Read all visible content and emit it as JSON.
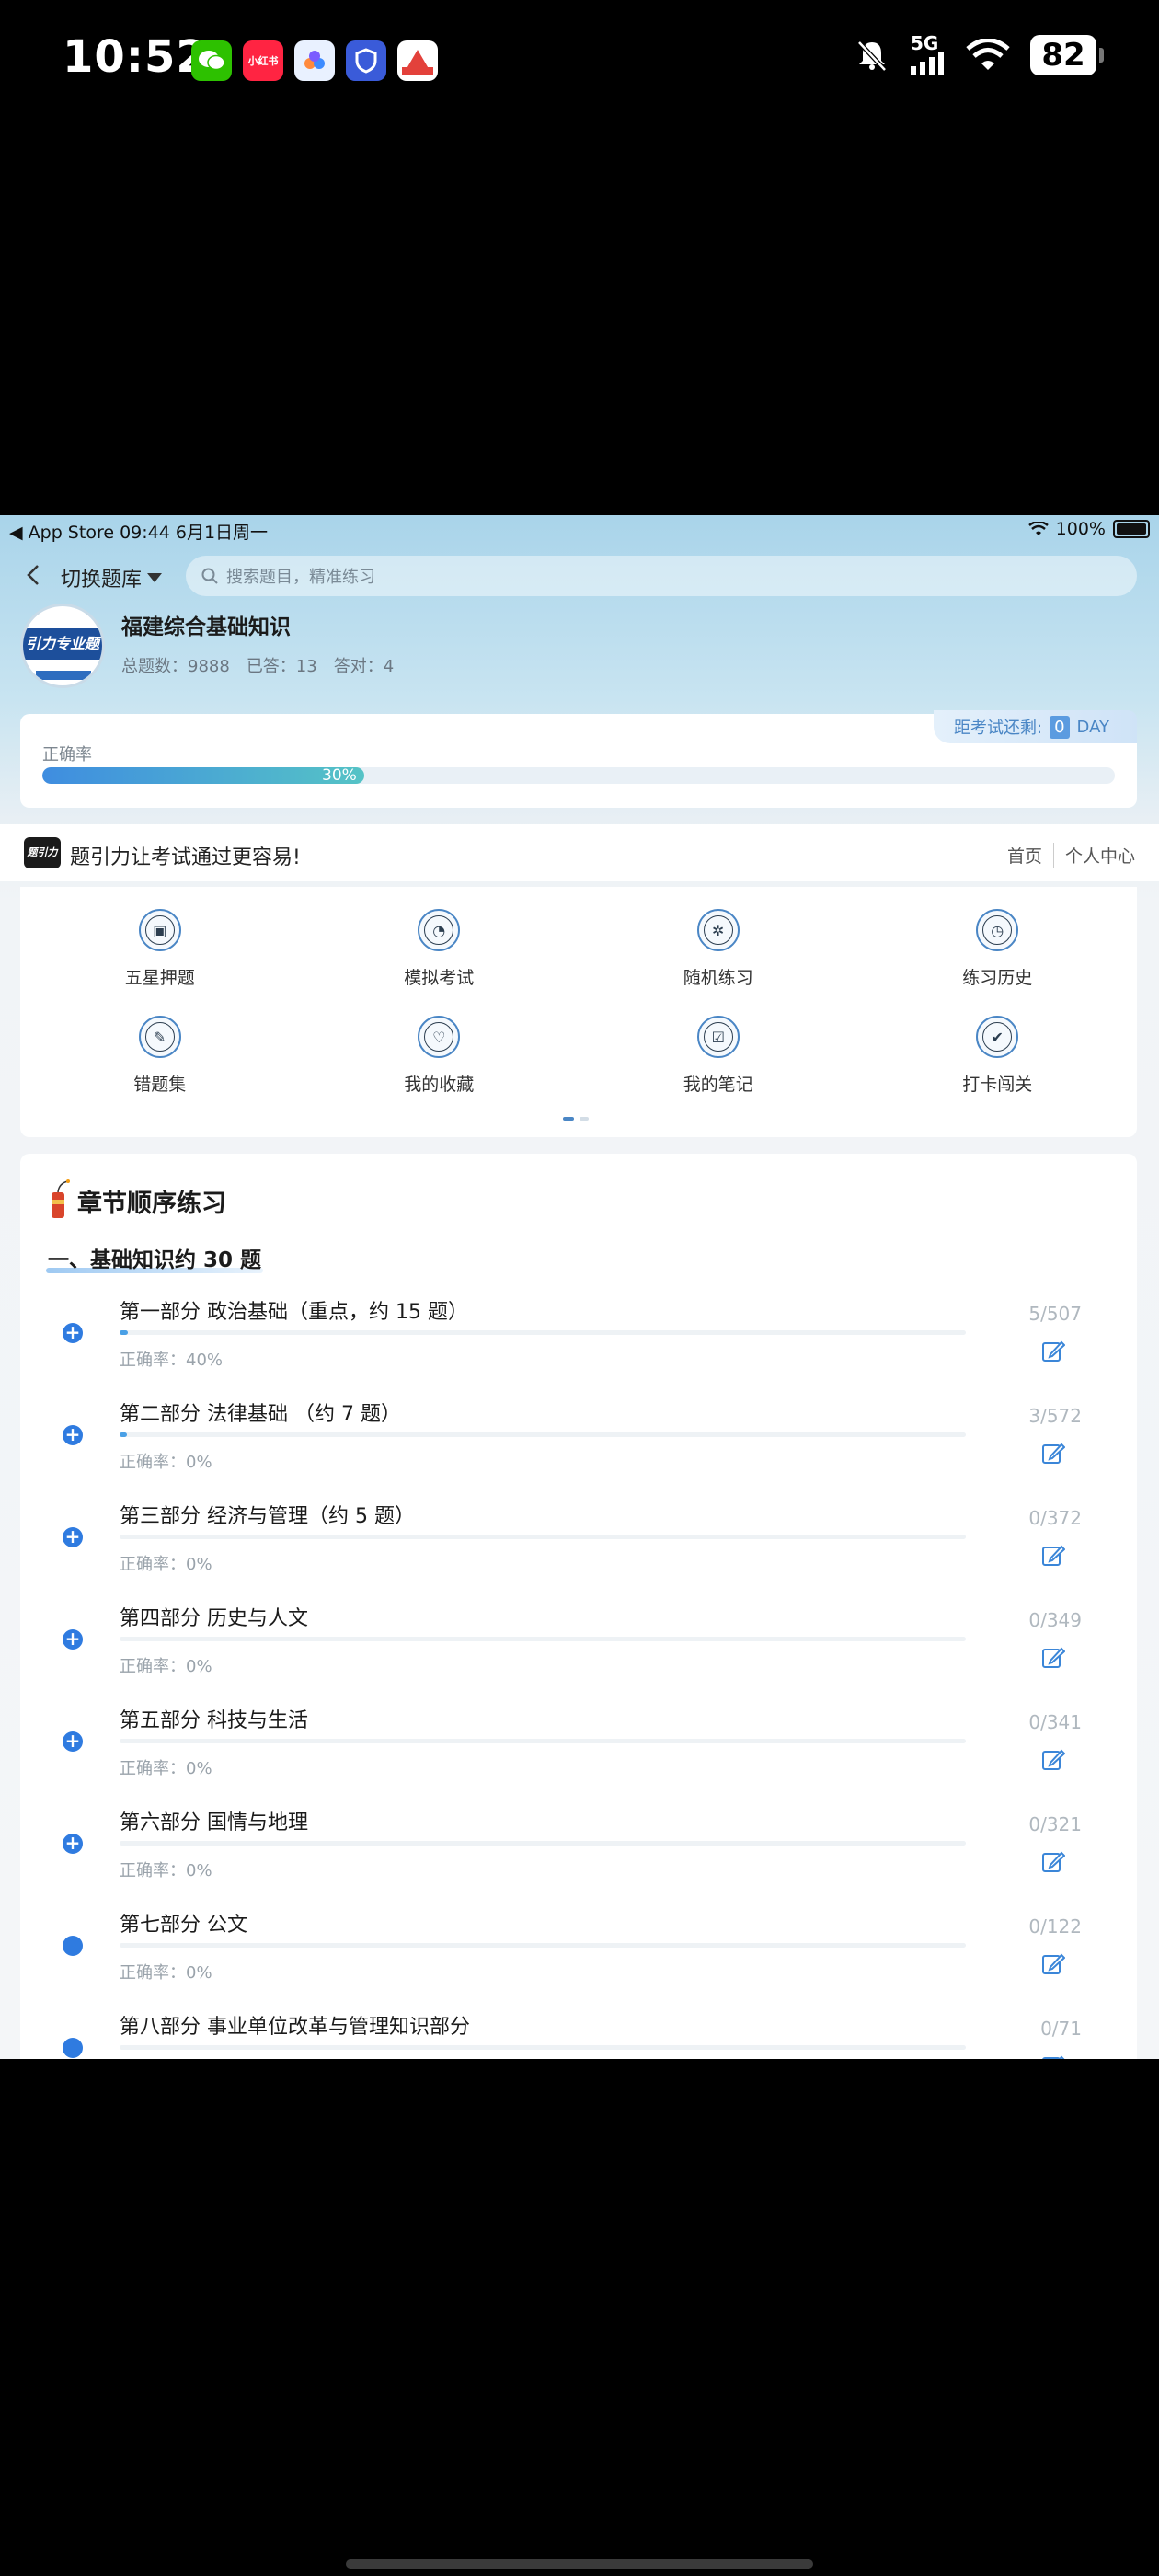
{
  "phone_status": {
    "time": "10:52",
    "network": "5G",
    "battery": "82",
    "apps": [
      {
        "name": "wechat-icon",
        "label": "",
        "color": "#2dc100"
      },
      {
        "name": "xiaohongshu-icon",
        "label": "小红书",
        "color": "#ff2442"
      },
      {
        "name": "app-cloud-icon",
        "label": "",
        "color": "#e9f1ff"
      },
      {
        "name": "app-shield-icon",
        "label": "",
        "color": "#3a5bd9"
      },
      {
        "name": "app-triangle-icon",
        "label": "",
        "color": "#e3413b"
      }
    ]
  },
  "inner_status": {
    "left": "◀ App Store  09:44  6月1日周一",
    "right": "100%"
  },
  "topbar": {
    "switch_label": "切换题库",
    "search_placeholder": "搜索题目，精准练习"
  },
  "bank": {
    "logo_text": "引力专业题",
    "name": "福建综合基础知识",
    "total": "总题数：9888",
    "answered": "已答：13",
    "correct": "答对：4"
  },
  "accuracy": {
    "label": "正确率",
    "value_text": "30%",
    "value": 30,
    "countdown_prefix": "距考试还剩:",
    "countdown_num": "0",
    "countdown_unit": "DAY"
  },
  "slogan": {
    "logo_text": "题引力",
    "text": "题引力让考试通过更容易!",
    "link_home": "首页",
    "link_profile": "个人中心"
  },
  "menu": [
    {
      "label": "五星押题",
      "icon": "id-card-icon",
      "glyph": "▣"
    },
    {
      "label": "模拟考试",
      "icon": "gauge-icon",
      "glyph": "◔"
    },
    {
      "label": "随机练习",
      "icon": "shuffle-icon",
      "glyph": "✲"
    },
    {
      "label": "练习历史",
      "icon": "history-icon",
      "glyph": "◷"
    },
    {
      "label": "错题集",
      "icon": "error-book-icon",
      "glyph": "✎"
    },
    {
      "label": "我的收藏",
      "icon": "heart-icon",
      "glyph": "♡"
    },
    {
      "label": "我的笔记",
      "icon": "note-icon",
      "glyph": "☑"
    },
    {
      "label": "打卡闯关",
      "icon": "checkin-icon",
      "glyph": "✔"
    }
  ],
  "chapters": {
    "title": "章节顺序练习",
    "section": "一、基础知识约 30 题",
    "items": [
      {
        "name": "第一部分 政治基础（重点，约 15 题）",
        "acc": "正确率：40%",
        "count": "5/507",
        "progress": 0.0099,
        "expandable": true
      },
      {
        "name": "第二部分 法律基础 （约 7 题）",
        "acc": "正确率：0%",
        "count": "3/572",
        "progress": 0.0052,
        "expandable": true
      },
      {
        "name": "第三部分 经济与管理（约 5 题）",
        "acc": "正确率：0%",
        "count": "0/372",
        "progress": 0,
        "expandable": true
      },
      {
        "name": "第四部分 历史与人文",
        "acc": "正确率：0%",
        "count": "0/349",
        "progress": 0,
        "expandable": true
      },
      {
        "name": "第五部分 科技与生活",
        "acc": "正确率：0%",
        "count": "0/341",
        "progress": 0,
        "expandable": true
      },
      {
        "name": "第六部分 国情与地理",
        "acc": "正确率：0%",
        "count": "0/321",
        "progress": 0,
        "expandable": true
      },
      {
        "name": "第七部分 公文",
        "acc": "正确率：0%",
        "count": "0/122",
        "progress": 0,
        "expandable": false
      },
      {
        "name": "第八部分 事业单位改革与管理知识部分",
        "acc": "",
        "count": "0/71",
        "progress": 0,
        "expandable": false
      }
    ]
  },
  "colors": {
    "accent": "#2f7be0",
    "progress_start": "#3f8de0",
    "progress_end": "#55c3c6"
  }
}
